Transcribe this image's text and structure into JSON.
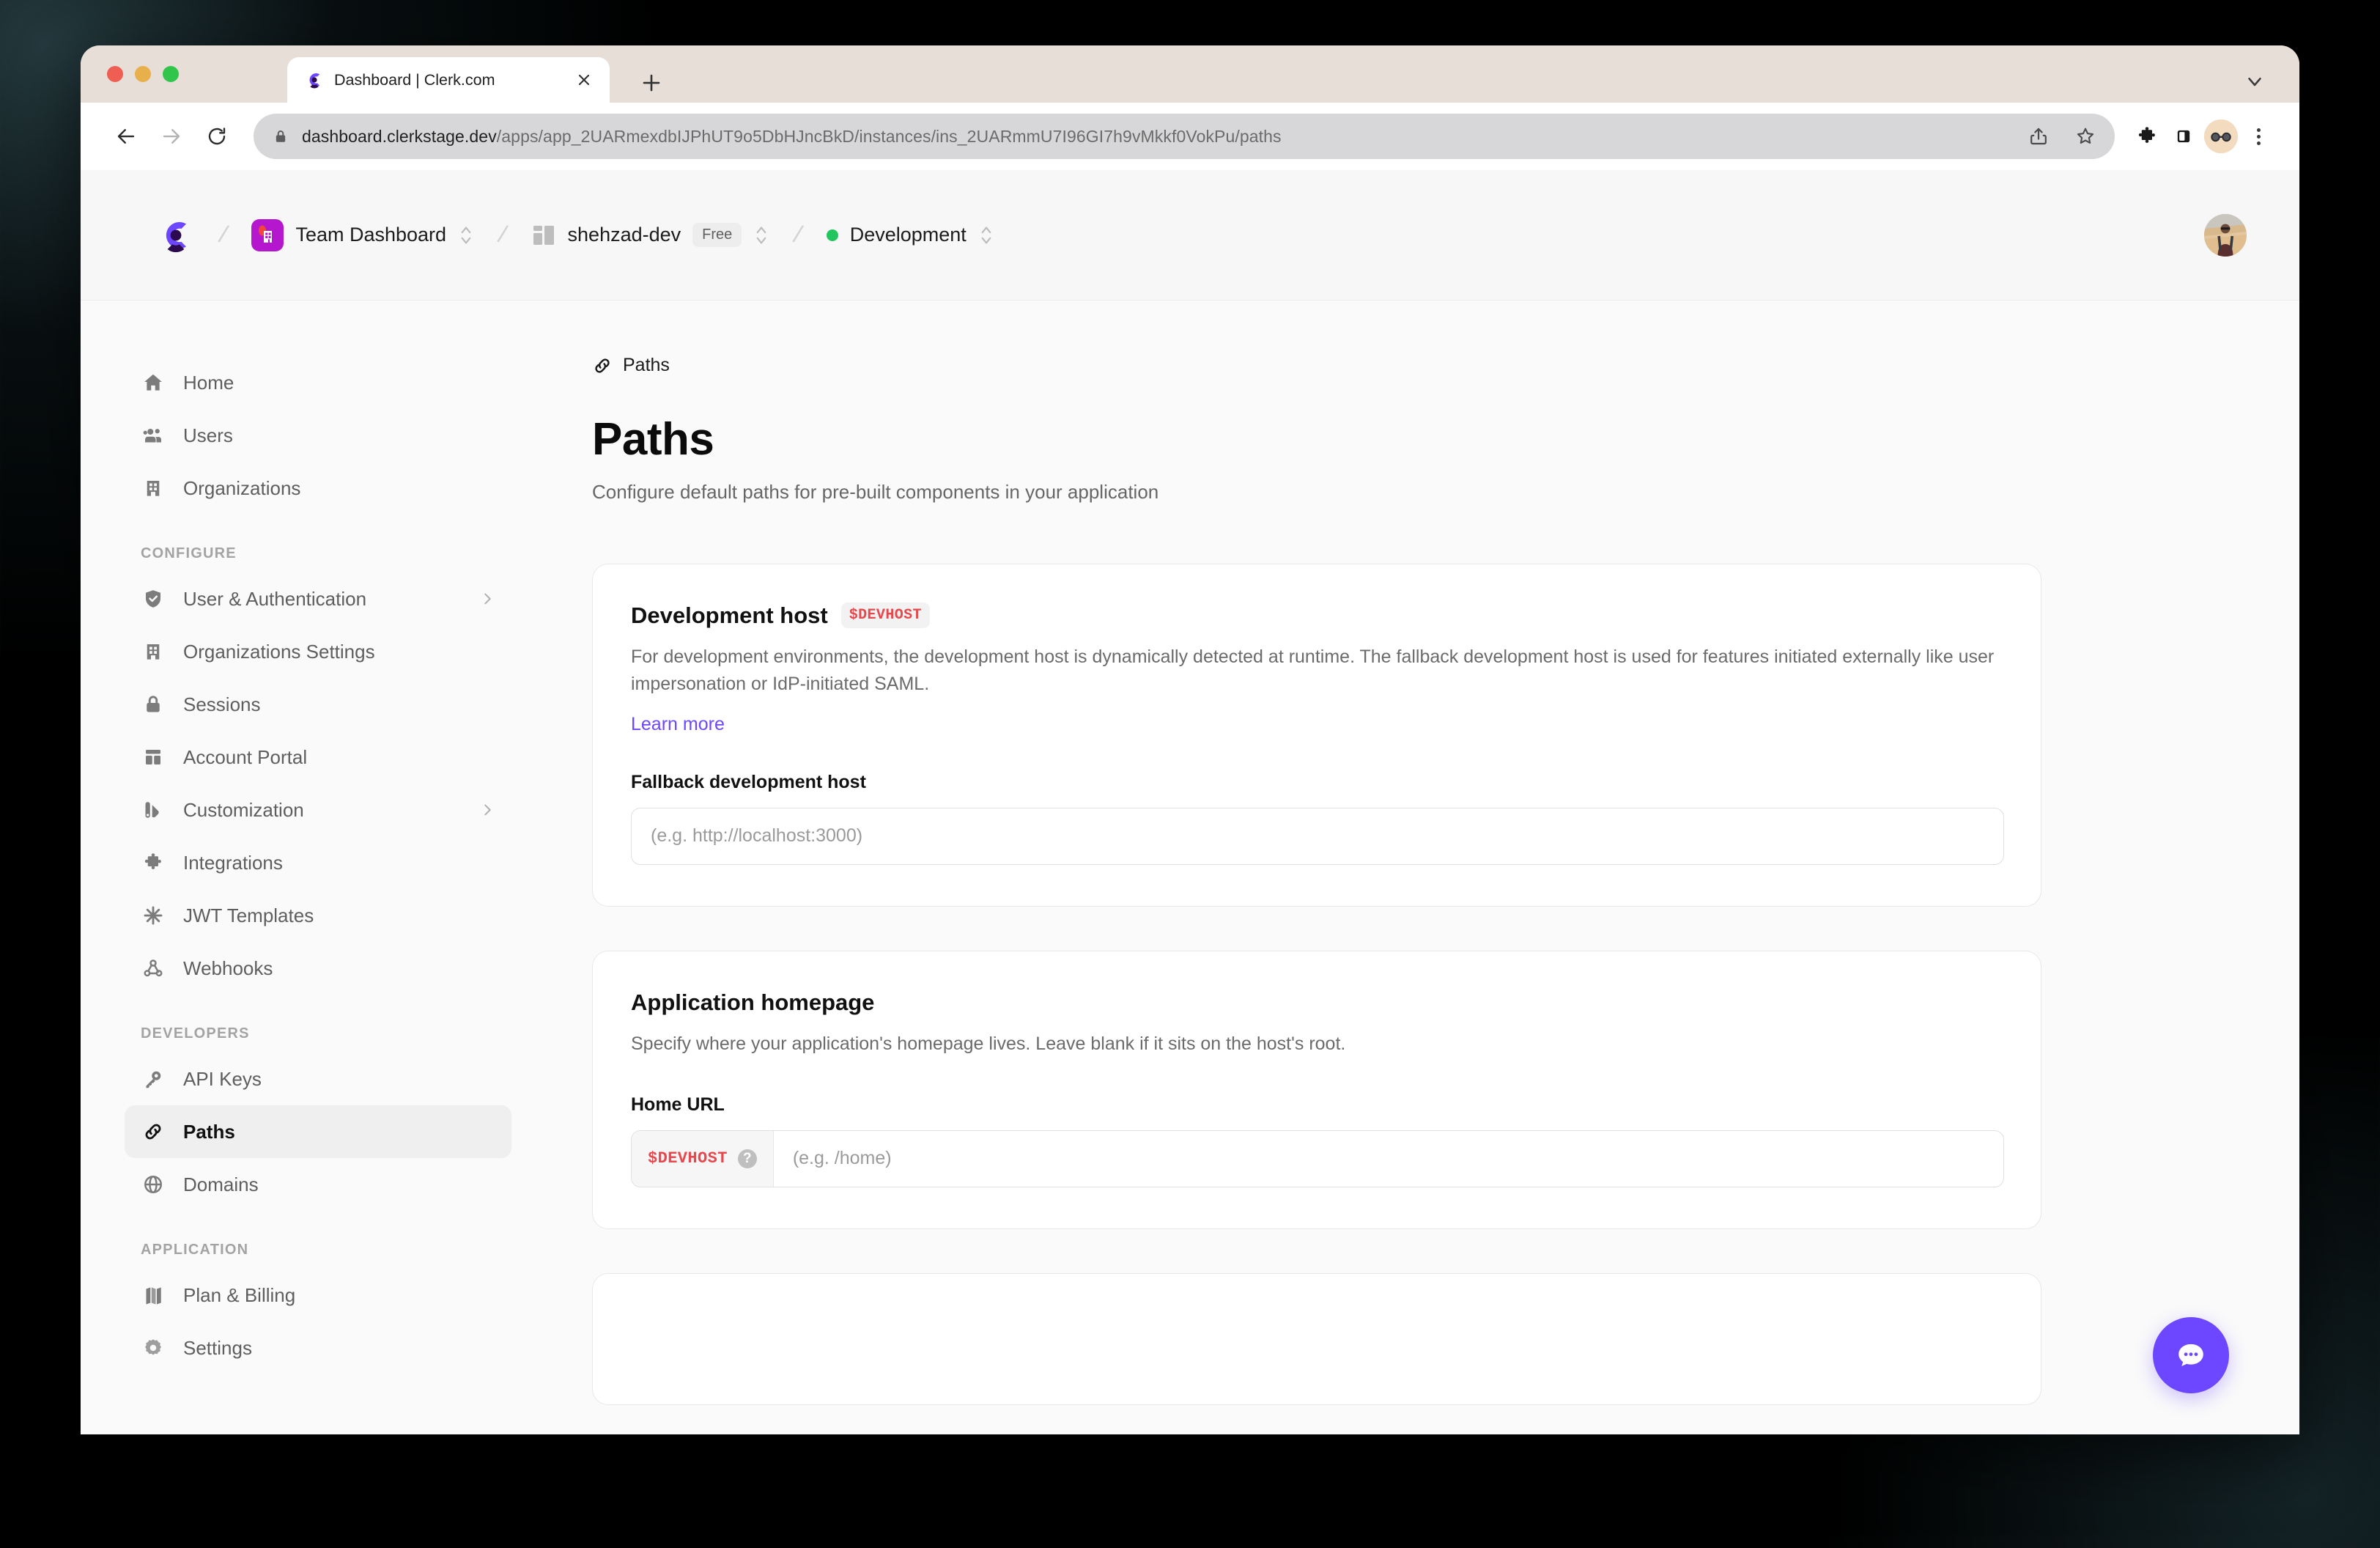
{
  "browser": {
    "tab": {
      "title": "Dashboard | Clerk.com",
      "favicon_icon": "clerk-logo-icon",
      "close_icon": "close-icon"
    },
    "new_tab_icon": "plus-icon",
    "tabstrip_chevron_icon": "chevron-down-icon",
    "nav": {
      "back_icon": "back-arrow-icon",
      "forward_icon": "forward-arrow-icon",
      "reload_icon": "reload-icon"
    },
    "omnibox": {
      "lock_icon": "lock-icon",
      "url_domain": "dashboard.clerkstage.dev",
      "url_path": "/apps/app_2UARmexdbIJPhUT9o5DbHJncBkD/instances/ins_2UARmmU7I96GI7h9vMkkf0VokPu/paths",
      "share_icon": "share-icon",
      "bookmark_icon": "star-icon"
    },
    "toolbar": {
      "extensions_icon": "puzzle-icon",
      "side_panel_icon": "side-panel-icon",
      "profile_icon": "profile-avatar",
      "menu_icon": "kebab-menu-icon"
    }
  },
  "appbar": {
    "logo_icon": "clerk-logo-icon",
    "separator": "/",
    "crumbs": [
      {
        "label": "Team Dashboard",
        "icon": "organization-avatar-icon",
        "switcher_icon": "chevron-up-down-icon",
        "badge": null,
        "status_dot": null
      },
      {
        "label": "shehzad-dev",
        "icon": "application-icon",
        "switcher_icon": "chevron-up-down-icon",
        "badge": "Free",
        "status_dot": null
      },
      {
        "label": "Development",
        "icon": null,
        "switcher_icon": "chevron-up-down-icon",
        "badge": null,
        "status_dot": "#22C55E"
      }
    ],
    "user_avatar_icon": "user-avatar"
  },
  "sidebar": {
    "groups": [
      {
        "heading": null,
        "items": [
          {
            "label": "Home",
            "icon": "home-icon",
            "active": false,
            "has_chevron": false
          },
          {
            "label": "Users",
            "icon": "users-icon",
            "active": false,
            "has_chevron": false
          },
          {
            "label": "Organizations",
            "icon": "building-icon",
            "active": false,
            "has_chevron": false
          }
        ]
      },
      {
        "heading": "CONFIGURE",
        "items": [
          {
            "label": "User & Authentication",
            "icon": "shield-check-icon",
            "active": false,
            "has_chevron": true
          },
          {
            "label": "Organizations Settings",
            "icon": "building-icon",
            "active": false,
            "has_chevron": false
          },
          {
            "label": "Sessions",
            "icon": "lock-icon",
            "active": false,
            "has_chevron": false
          },
          {
            "label": "Account Portal",
            "icon": "layout-icon",
            "active": false,
            "has_chevron": false
          },
          {
            "label": "Customization",
            "icon": "palette-icon",
            "active": false,
            "has_chevron": true
          },
          {
            "label": "Integrations",
            "icon": "puzzle-icon",
            "active": false,
            "has_chevron": false
          },
          {
            "label": "JWT Templates",
            "icon": "asterisk-icon",
            "active": false,
            "has_chevron": false
          },
          {
            "label": "Webhooks",
            "icon": "webhook-icon",
            "active": false,
            "has_chevron": false
          }
        ]
      },
      {
        "heading": "DEVELOPERS",
        "items": [
          {
            "label": "API Keys",
            "icon": "key-icon",
            "active": false,
            "has_chevron": false
          },
          {
            "label": "Paths",
            "icon": "link-icon",
            "active": true,
            "has_chevron": false
          },
          {
            "label": "Domains",
            "icon": "globe-icon",
            "active": false,
            "has_chevron": false
          }
        ]
      },
      {
        "heading": "APPLICATION",
        "items": [
          {
            "label": "Plan & Billing",
            "icon": "billing-icon",
            "active": false,
            "has_chevron": false
          },
          {
            "label": "Settings",
            "icon": "gear-icon",
            "active": false,
            "has_chevron": false
          }
        ]
      }
    ]
  },
  "main": {
    "breadcrumb": {
      "label": "Paths",
      "icon": "link-icon"
    },
    "title": "Paths",
    "subtitle": "Configure default paths for pre-built components in your application",
    "cards": [
      {
        "title": "Development host",
        "badge": "$DEVHOST",
        "description": "For development environments, the development host is dynamically detected at runtime. The fallback development host is used for features initiated externally like user impersonation or IdP-initiated SAML.",
        "link_label": "Learn more",
        "field_label": "Fallback development host",
        "input_placeholder": "(e.g. http://localhost:3000)",
        "input_value": "",
        "input_prefix": null
      },
      {
        "title": "Application homepage",
        "badge": null,
        "description": "Specify where your application's homepage lives. Leave blank if it sits on the host's root.",
        "link_label": null,
        "field_label": "Home URL",
        "input_placeholder": "(e.g. /home)",
        "input_value": "",
        "input_prefix": "$DEVHOST",
        "input_prefix_help_icon": "help-icon"
      }
    ]
  },
  "chat_widget": {
    "icon": "chat-bubble-icon",
    "color": "#6C47FF"
  },
  "colors": {
    "accent": "#6C47FF",
    "token_red": "#E5484D",
    "env_green": "#22C55E",
    "page_bg": "#FAFAFA",
    "card_bg": "#FFFFFF",
    "card_border": "#E8E8E8",
    "browser_chrome": "#E8DED8"
  }
}
